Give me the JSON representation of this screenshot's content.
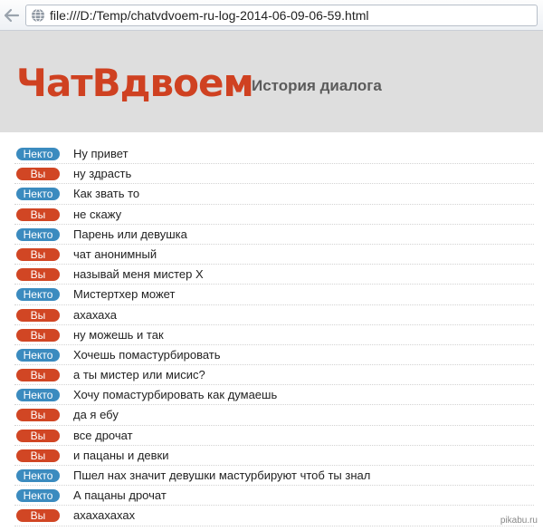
{
  "browser": {
    "url": "file:///D:/Temp/chatvdvoem-ru-log-2014-06-09-06-59.html",
    "icon": "globe-icon"
  },
  "header": {
    "logo": "ЧатВдвоем",
    "subtitle": "История диалога"
  },
  "colors": {
    "logo": "#cf4121",
    "stranger_badge": "#3b8bbf",
    "you_badge": "#d14624",
    "header_bg": "#dedede"
  },
  "messages": [
    {
      "sender": "stranger",
      "label": "Некто",
      "text": "Ну привет"
    },
    {
      "sender": "you",
      "label": "Вы",
      "text": "ну здрасть"
    },
    {
      "sender": "stranger",
      "label": "Некто",
      "text": "Как звать то"
    },
    {
      "sender": "you",
      "label": "Вы",
      "text": "не скажу"
    },
    {
      "sender": "stranger",
      "label": "Некто",
      "text": "Парень или девушка"
    },
    {
      "sender": "you",
      "label": "Вы",
      "text": "чат анонимный"
    },
    {
      "sender": "you",
      "label": "Вы",
      "text": "называй меня мистер Х"
    },
    {
      "sender": "stranger",
      "label": "Некто",
      "text": "Мистертхер может"
    },
    {
      "sender": "you",
      "label": "Вы",
      "text": "ахахаха"
    },
    {
      "sender": "you",
      "label": "Вы",
      "text": "ну можешь и так"
    },
    {
      "sender": "stranger",
      "label": "Некто",
      "text": "Хочешь помастурбировать"
    },
    {
      "sender": "you",
      "label": "Вы",
      "text": "а ты мистер или мисис?"
    },
    {
      "sender": "stranger",
      "label": "Некто",
      "text": "Хочу помастурбировать как думаешь"
    },
    {
      "sender": "you",
      "label": "Вы",
      "text": "да я ебу"
    },
    {
      "sender": "you",
      "label": "Вы",
      "text": "все дрочат"
    },
    {
      "sender": "you",
      "label": "Вы",
      "text": "и пацаны и девки"
    },
    {
      "sender": "stranger",
      "label": "Некто",
      "text": "Пшел нах значит девушки мастурбируют чтоб ты знал"
    },
    {
      "sender": "stranger",
      "label": "Некто",
      "text": "А пацаны дрочат"
    },
    {
      "sender": "you",
      "label": "Вы",
      "text": "ахахахахах"
    }
  ],
  "watermark": "pikabu.ru"
}
